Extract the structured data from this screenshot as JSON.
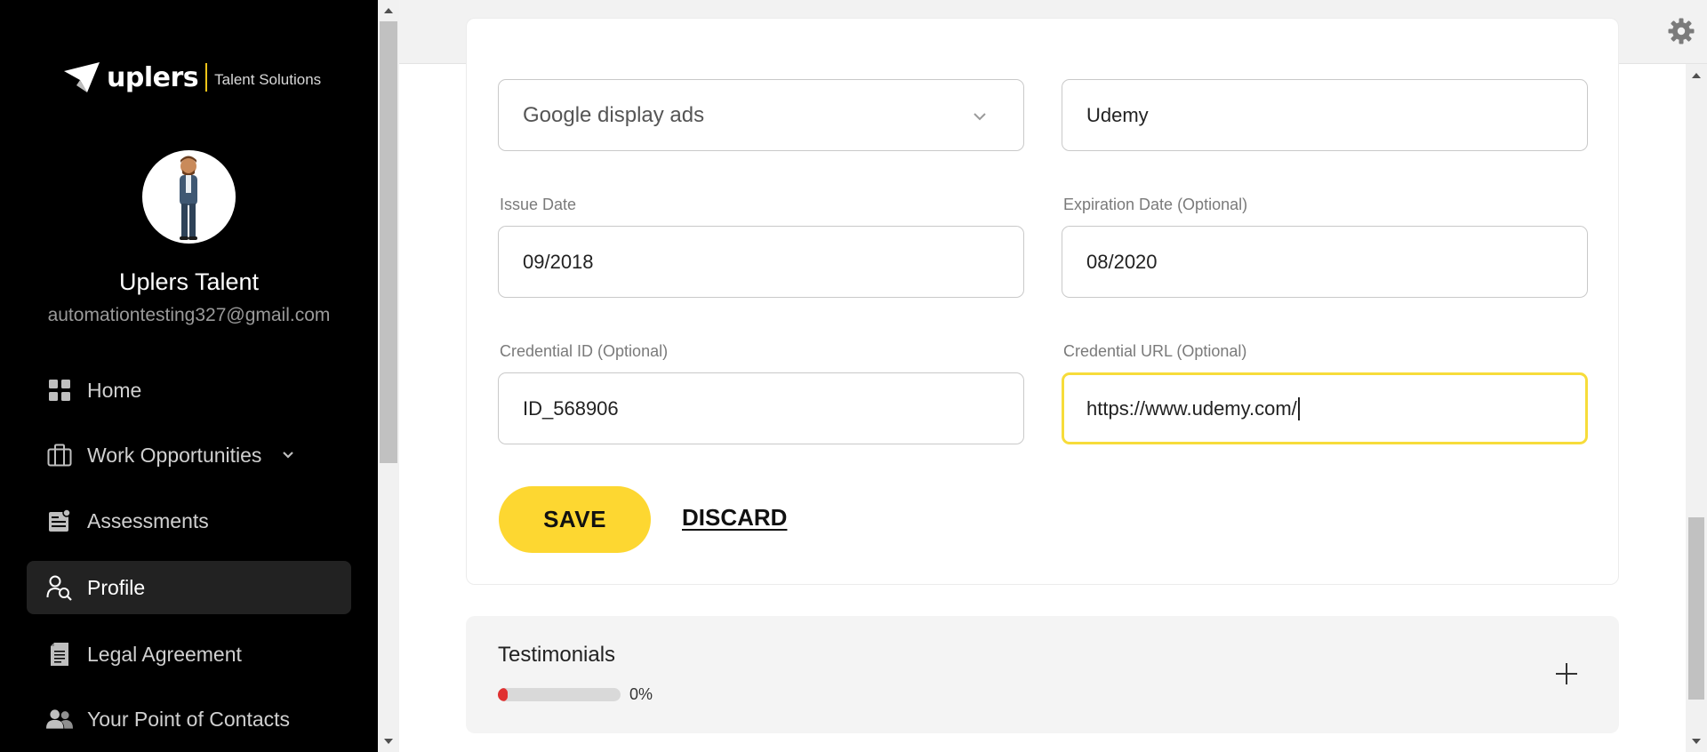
{
  "brand": {
    "logo_text": "uplers",
    "logo_subtext": "Talent Solutions",
    "accent_color": "#fdd731"
  },
  "user": {
    "name": "Uplers Talent",
    "email": "automationtesting327@gmail.com"
  },
  "nav": {
    "items": [
      {
        "label": "Home",
        "icon": "grid-icon"
      },
      {
        "label": "Work Opportunities",
        "icon": "briefcase-icon"
      },
      {
        "label": "Assessments",
        "icon": "assessment-icon"
      },
      {
        "label": "Profile",
        "icon": "profile-search-icon",
        "active": true
      },
      {
        "label": "Legal Agreement",
        "icon": "document-icon"
      },
      {
        "label": "Your Point of Contacts",
        "icon": "contacts-icon"
      }
    ]
  },
  "form": {
    "certification_select": {
      "value": "Google display ads"
    },
    "issuing_org": {
      "value": "Udemy"
    },
    "issue_date": {
      "label": "Issue Date",
      "value": "09/2018"
    },
    "expiration_date": {
      "label": "Expiration Date (Optional)",
      "value": "08/2020"
    },
    "credential_id": {
      "label": "Credential ID (Optional)",
      "value": "ID_568906"
    },
    "credential_url": {
      "label": "Credential URL (Optional)",
      "value": "https://www.udemy.com/"
    },
    "save_label": "SAVE",
    "discard_label": "DISCARD"
  },
  "testimonials": {
    "title": "Testimonials",
    "progress_text": "0%",
    "progress_value": 0,
    "progress_color": "#e03131"
  }
}
